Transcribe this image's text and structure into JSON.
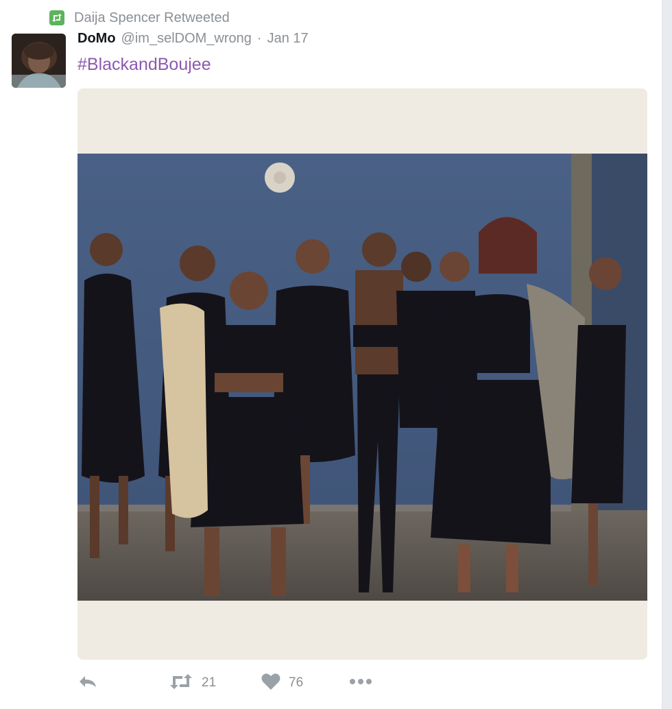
{
  "retweet_context": {
    "icon": "retweet-icon",
    "text": "Daija Spencer Retweeted",
    "badge_color": "#5fb35d"
  },
  "tweet": {
    "author_name": "DoMo",
    "author_handle": "@im_selDOM_wrong",
    "separator": "·",
    "date": "Jan 17",
    "text": "#BlackandBoujee",
    "hashtag_color": "#8c59b0",
    "avatar": "user-avatar",
    "media": "group-photo"
  },
  "actions": {
    "reply": {
      "icon": "reply-icon"
    },
    "retweet": {
      "icon": "retweet-icon",
      "count": "21"
    },
    "like": {
      "icon": "heart-icon",
      "count": "76"
    },
    "more": {
      "icon": "more-icon"
    }
  },
  "colors": {
    "text_primary": "#14171a",
    "text_secondary": "#8a8f94",
    "media_background": "#efebe2"
  }
}
